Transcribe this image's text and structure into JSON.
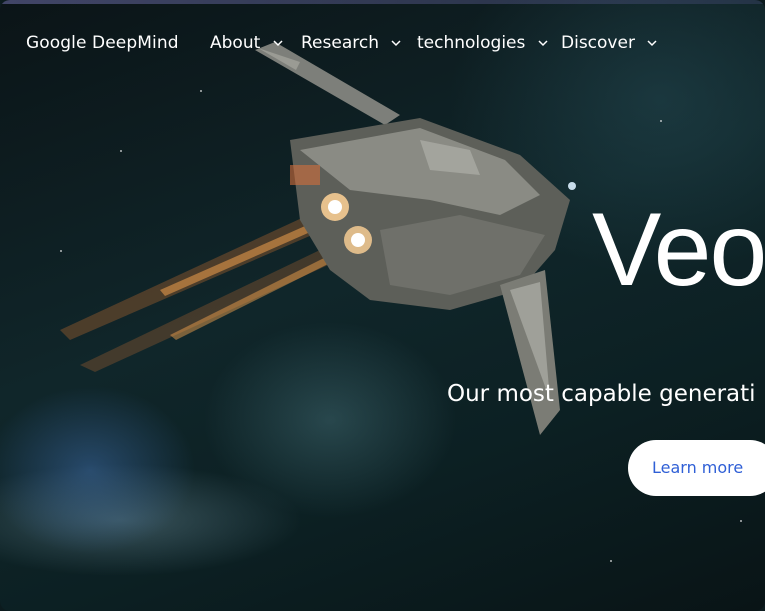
{
  "header": {
    "brand": "Google DeepMind",
    "nav": [
      {
        "label": "About",
        "icon": "chevron-down-icon"
      },
      {
        "label": "Research",
        "icon": "chevron-down-icon"
      },
      {
        "label": "technologies",
        "icon": "chevron-down-icon"
      },
      {
        "label": "Discover",
        "icon": "chevron-down-icon"
      }
    ]
  },
  "hero": {
    "title": "Veo",
    "subtitle": "Our most capable generati",
    "cta_label": "Learn more"
  },
  "colors": {
    "text": "#ffffff",
    "cta_background": "#ffffff",
    "cta_text": "#2f5fd6",
    "background": "#0c1b1e"
  }
}
